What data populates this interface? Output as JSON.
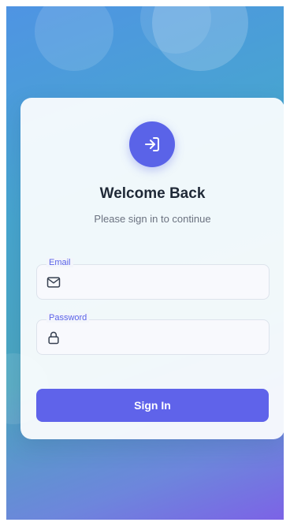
{
  "login": {
    "title": "Welcome Back",
    "subtitle": "Please sign in to continue",
    "email_label": "Email",
    "email_value": "",
    "password_label": "Password",
    "password_value": "",
    "submit_label": "Sign In"
  },
  "icons": {
    "login_icon": "sign-in-icon",
    "email_icon": "mail-icon",
    "password_icon": "lock-icon"
  },
  "colors": {
    "accent": "#5a63e8",
    "button": "#5f63ea",
    "title_text": "#1f2937",
    "subtitle_text": "#6b7280"
  }
}
